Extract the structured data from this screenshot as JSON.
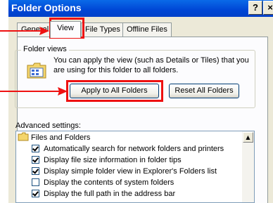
{
  "window": {
    "title": "Folder Options",
    "help_glyph": "?",
    "close_glyph": "×"
  },
  "tabs": [
    {
      "label": "General"
    },
    {
      "label": "View"
    },
    {
      "label": "File Types"
    },
    {
      "label": "Offline Files"
    }
  ],
  "folder_views": {
    "label": "Folder views",
    "description": "You can apply the view (such as Details or Tiles) that you are using for this folder to all folders.",
    "apply_button": "Apply to All Folders",
    "reset_button": "Reset All Folders"
  },
  "advanced": {
    "label": "Advanced settings:",
    "tree_root": "Files and Folders",
    "items": [
      {
        "label": "Automatically search for network folders and printers",
        "checked": true
      },
      {
        "label": "Display file size information in folder tips",
        "checked": true
      },
      {
        "label": "Display simple folder view in Explorer's Folders list",
        "checked": true
      },
      {
        "label": "Display the contents of system folders",
        "checked": false
      },
      {
        "label": "Display the full path in the address bar",
        "checked": true
      }
    ]
  },
  "annotation_color": "#ee1111"
}
